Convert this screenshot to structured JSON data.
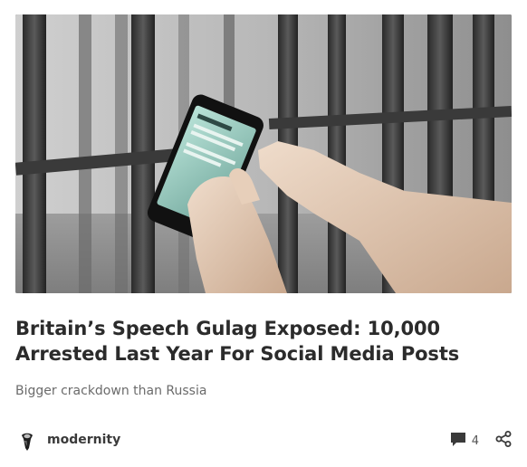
{
  "post": {
    "title": "Britain’s Speech Gulag Exposed: 10,000 Arrested Last Year For Social Media Posts",
    "subtitle": "Bigger crackdown than Russia",
    "author": "modernity",
    "comment_count": "4",
    "image_icon": "prison-bars-phone-photo"
  },
  "icons": {
    "comment": "comment-bubble-icon",
    "share": "share-icon",
    "avatar": "author-avatar"
  },
  "colors": {
    "title": "#2b2b2b",
    "subtitle": "#6b6b6b",
    "icon": "#3a3a3a"
  }
}
